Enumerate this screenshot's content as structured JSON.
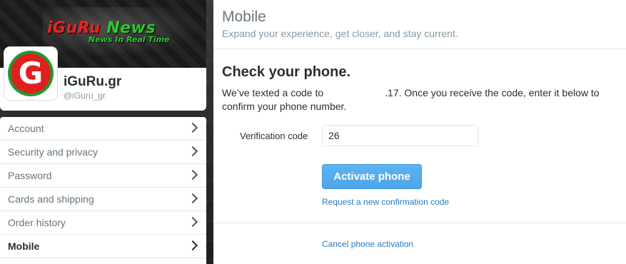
{
  "profile": {
    "banner_title_red": "iGuRu",
    "banner_title_green": " News",
    "banner_tagline": "News In Real Time",
    "avatar_letter": "G",
    "name": "iGuRu.gr",
    "handle": "@iGuru_gr"
  },
  "sidebar": {
    "items": [
      {
        "label": "Account",
        "active": false
      },
      {
        "label": "Security and privacy",
        "active": false
      },
      {
        "label": "Password",
        "active": false
      },
      {
        "label": "Cards and shipping",
        "active": false
      },
      {
        "label": "Order history",
        "active": false
      },
      {
        "label": "Mobile",
        "active": true
      }
    ]
  },
  "main": {
    "title": "Mobile",
    "subtitle": "Expand your experience, get closer, and stay current.",
    "section_title": "Check your phone.",
    "intro_before": "We’ve texted a code to",
    "intro_after": ".17. Once you receive the code, enter it below to confirm your phone number.",
    "code_label": "Verification code",
    "code_value": "26",
    "activate_label": "Activate phone",
    "request_link": "Request a new confirmation code",
    "cancel_link": "Cancel phone activation"
  },
  "colors": {
    "link": "#2b7bb9",
    "button": "#55acee",
    "avatar_red": "#e02020",
    "avatar_green": "#1a9c2e"
  }
}
